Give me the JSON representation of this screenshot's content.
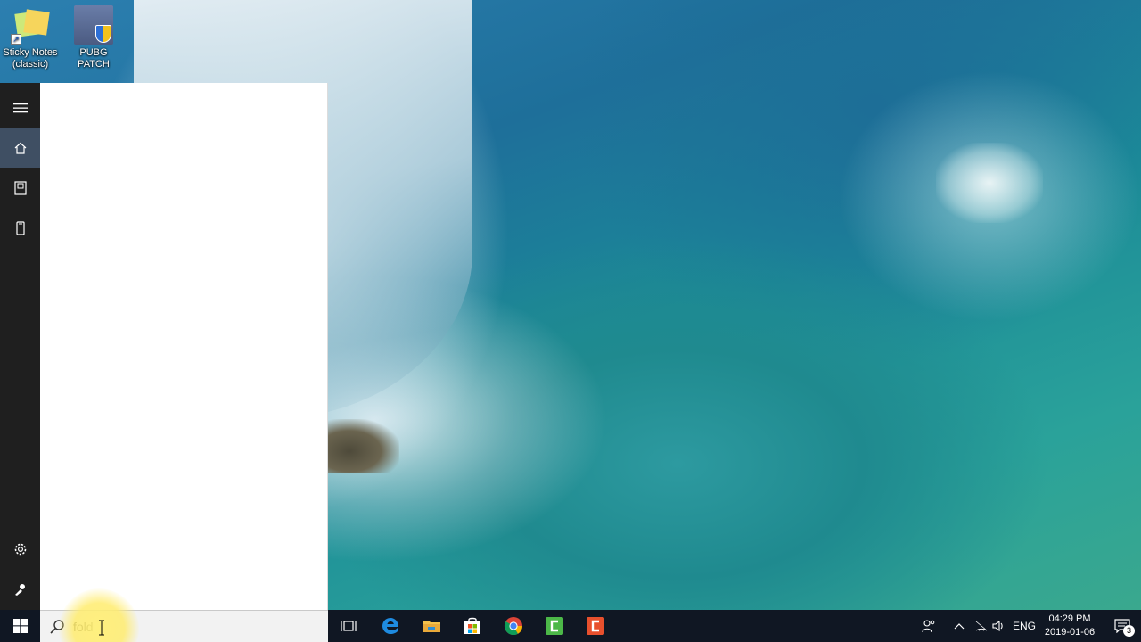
{
  "desktop": {
    "icons": [
      {
        "label_line1": "Sticky Notes",
        "label_line2": "(classic)",
        "icon": "sticky-notes-icon"
      },
      {
        "label_line1": "PUBG PATCH",
        "label_line2": "",
        "icon": "pubg-patch-icon"
      }
    ]
  },
  "start_menu": {
    "rail": [
      {
        "name": "hamburger-menu",
        "icon": "hamburger-icon"
      },
      {
        "name": "home",
        "icon": "home-icon",
        "active": true
      },
      {
        "name": "documents",
        "icon": "document-icon"
      },
      {
        "name": "device",
        "icon": "phone-icon"
      },
      {
        "name": "settings",
        "icon": "gear-icon"
      },
      {
        "name": "feedback",
        "icon": "feedback-icon"
      }
    ]
  },
  "search": {
    "value": "fold",
    "placeholder": ""
  },
  "taskbar": {
    "apps": [
      {
        "name": "task-view",
        "icon": "task-view-icon"
      },
      {
        "name": "edge",
        "icon": "edge-icon"
      },
      {
        "name": "file-explorer",
        "icon": "folder-icon"
      },
      {
        "name": "store",
        "icon": "store-icon"
      },
      {
        "name": "chrome",
        "icon": "chrome-icon"
      },
      {
        "name": "camtasia-green",
        "icon": "camtasia-green-icon"
      },
      {
        "name": "camtasia-red",
        "icon": "camtasia-red-icon"
      }
    ],
    "tray": {
      "language": "ENG",
      "time": "04:29 PM",
      "date": "2019-01-06",
      "notification_count": "3"
    }
  },
  "colors": {
    "taskbar": "#101723",
    "rail": "#1f1f1f",
    "rail_active": "#3f4f63",
    "search_box": "#f2f2f2"
  }
}
